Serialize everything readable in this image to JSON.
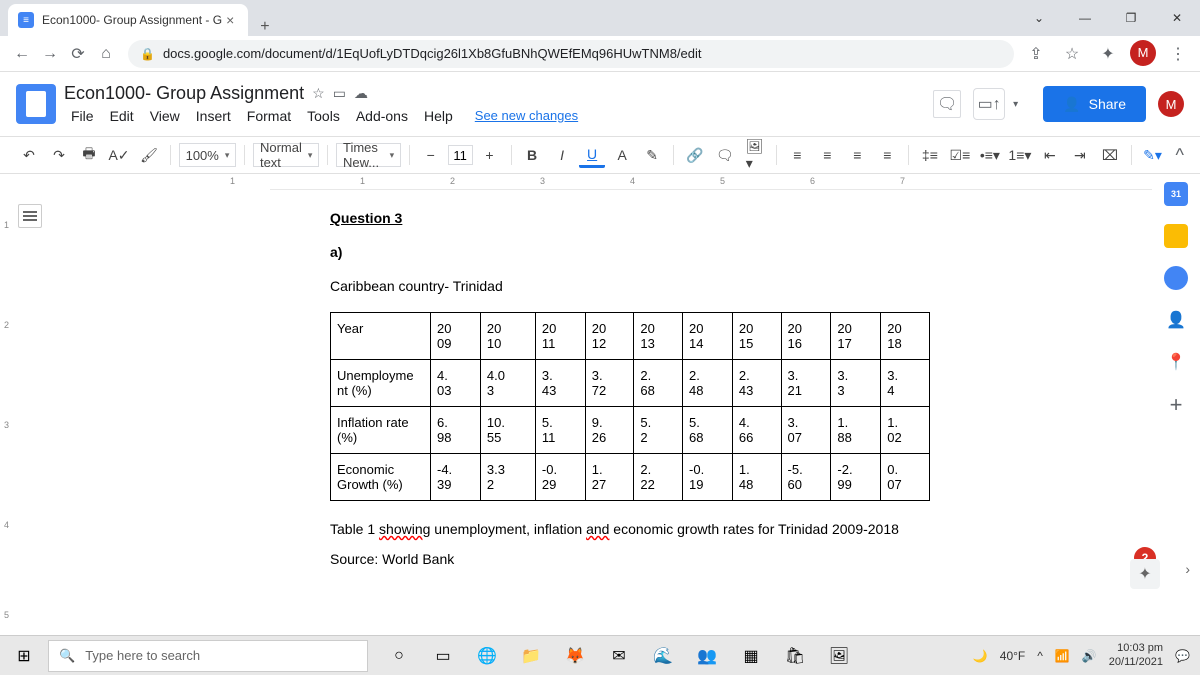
{
  "tab": {
    "title": "Econ1000- Group Assignment - G"
  },
  "url": "docs.google.com/document/d/1EqUofLyDTDqcig26l1Xb8GfuBNhQWEfEMq96HUwTNM8/edit",
  "doc": {
    "title": "Econ1000- Group Assignment",
    "menu": [
      "File",
      "Edit",
      "View",
      "Insert",
      "Format",
      "Tools",
      "Add-ons",
      "Help"
    ],
    "see_changes": "See new changes",
    "share": "Share"
  },
  "toolbar": {
    "zoom": "100%",
    "style": "Normal text",
    "font": "Times New...",
    "size": "11"
  },
  "content": {
    "q3": "Question 3",
    "a": "a)",
    "country": "Caribbean country- Trinidad",
    "caption_pre": "Table 1 ",
    "caption_showing": "showing",
    "caption_mid": " unemployment, inflation ",
    "caption_and": "and",
    "caption_post": " economic growth rates for Trinidad 2009-2018",
    "source": "Source: World Bank"
  },
  "chart_data": {
    "type": "table",
    "title": "Unemployment, inflation and economic growth rates for Trinidad 2009-2018",
    "row_labels": [
      "Year",
      "Unemployment (%)",
      "Inflation rate (%)",
      "Economic Growth (%)"
    ],
    "columns": [
      "2009",
      "2010",
      "2011",
      "2012",
      "2013",
      "2014",
      "2015",
      "2016",
      "2017",
      "2018"
    ],
    "rows": {
      "Year": [
        "2009",
        "2010",
        "2011",
        "2012",
        "2013",
        "2014",
        "2015",
        "2016",
        "2017",
        "2018"
      ],
      "Unemployment (%)": [
        4.03,
        4.03,
        3.43,
        3.72,
        2.68,
        2.48,
        2.43,
        3.21,
        3.3,
        3.4
      ],
      "Inflation rate (%)": [
        6.98,
        10.55,
        5.11,
        9.26,
        5.2,
        5.68,
        4.66,
        3.07,
        1.88,
        1.02
      ],
      "Economic Growth (%)": [
        -4.39,
        3.32,
        -0.29,
        1.27,
        2.22,
        -0.19,
        1.48,
        -5.6,
        -2.99,
        0.07
      ]
    }
  },
  "table": {
    "r0": {
      "label": "Year",
      "c": [
        "20\n09",
        "20\n10",
        "20\n11",
        "20\n12",
        "20\n13",
        "20\n14",
        "20\n15",
        "20\n16",
        "20\n17",
        "20\n18"
      ]
    },
    "r1": {
      "label": "Unemployme\nnt (%)",
      "c": [
        "4.\n03",
        "4.0\n3",
        "3.\n43",
        "3.\n72",
        "2.\n68",
        "2.\n48",
        "2.\n43",
        "3.\n21",
        "3.\n3",
        "3.\n4"
      ]
    },
    "r2": {
      "label": "Inflation rate\n(%)",
      "c": [
        "6.\n98",
        "10.\n55",
        "5.\n11",
        "9.\n26",
        "5.\n2",
        "5.\n68",
        "4.\n66",
        "3.\n07",
        "1.\n88",
        "1.\n02"
      ]
    },
    "r3": {
      "label": "Economic\nGrowth (%)",
      "c": [
        "-4.\n39",
        "3.3\n2",
        "-0.\n29",
        "1.\n27",
        "2.\n22",
        "-0.\n19",
        "1.\n48",
        "-5.\n60",
        "-2.\n99",
        "0.\n07"
      ]
    }
  },
  "taskbar": {
    "search": "Type here to search",
    "temp": "40°F",
    "time": "10:03 pm",
    "date": "20/11/2021"
  },
  "badge": "2",
  "avatar": "M",
  "calendar_day": "31"
}
